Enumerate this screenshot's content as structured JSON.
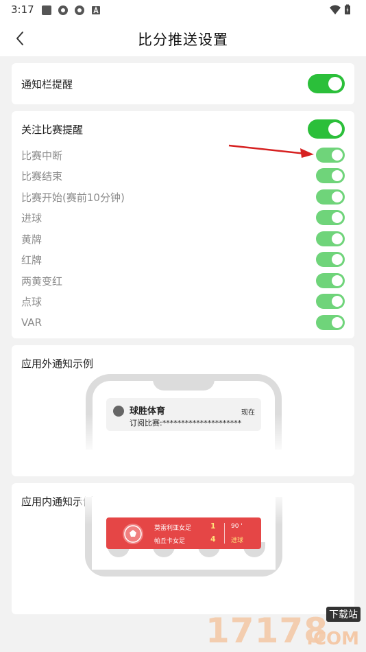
{
  "status_bar": {
    "time": "3:17"
  },
  "header": {
    "title": "比分推送设置"
  },
  "notification_bar": {
    "label": "通知栏提醒",
    "enabled": true
  },
  "follow_match": {
    "label": "关注比赛提醒",
    "enabled": true,
    "items": [
      {
        "label": "比赛中断",
        "enabled": true
      },
      {
        "label": "比赛结束",
        "enabled": true
      },
      {
        "label": "比赛开始(赛前10分钟)",
        "enabled": true
      },
      {
        "label": "进球",
        "enabled": true
      },
      {
        "label": "黄牌",
        "enabled": true
      },
      {
        "label": "红牌",
        "enabled": true
      },
      {
        "label": "两黄变红",
        "enabled": true
      },
      {
        "label": "点球",
        "enabled": true
      },
      {
        "label": "VAR",
        "enabled": true
      }
    ]
  },
  "outside_example": {
    "title": "应用外通知示例",
    "app_name": "球胜体育",
    "time": "现在",
    "body": "订阅比赛:*********************"
  },
  "inside_example": {
    "title": "应用内通知示例",
    "team_home": "莫雷利亚女足",
    "team_away": "帕丘卡女足",
    "score_home": "1",
    "score_away": "4",
    "minute": "90 '",
    "event": "进球"
  },
  "watermark": {
    "number": "17178",
    "tag": "下载站",
    "domain": ".COM"
  },
  "colors": {
    "toggle_on": "#2bbf3a",
    "toggle_sub_on": "#6fd47a",
    "banner": "#e54646",
    "arrow": "#d62020"
  }
}
